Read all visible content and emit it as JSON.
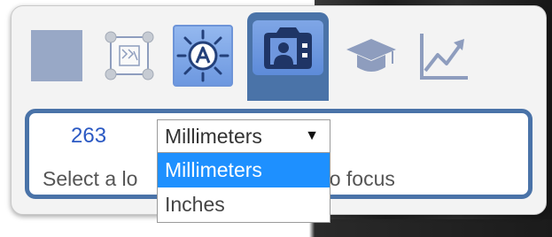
{
  "toolbar": {
    "tools": [
      {
        "name": "blank-tool",
        "icon": "square-icon",
        "state": "disabled"
      },
      {
        "name": "crop-tool",
        "icon": "crop-frame-icon",
        "state": "disabled"
      },
      {
        "name": "auto-exposure-tool",
        "icon": "sun-a-icon",
        "state": "hover"
      },
      {
        "name": "focus-tool",
        "icon": "camera-portrait-icon",
        "state": "selected"
      },
      {
        "name": "learn-tool",
        "icon": "graduation-cap-icon",
        "state": "disabled"
      },
      {
        "name": "chart-tool",
        "icon": "line-chart-icon",
        "state": "disabled"
      }
    ]
  },
  "focus_options": {
    "distance_value": "263",
    "unit_select": {
      "selected": "Millimeters",
      "arrow": "▼",
      "options": [
        "Millimeters",
        "Inches"
      ],
      "highlighted": "Millimeters"
    },
    "hint_before": "Select a lo",
    "hint_after": "age to auto focus"
  },
  "colors": {
    "accent_blue": "#4a73a8",
    "value_blue": "#2b59c3",
    "option_highlight": "#1e90ff"
  }
}
